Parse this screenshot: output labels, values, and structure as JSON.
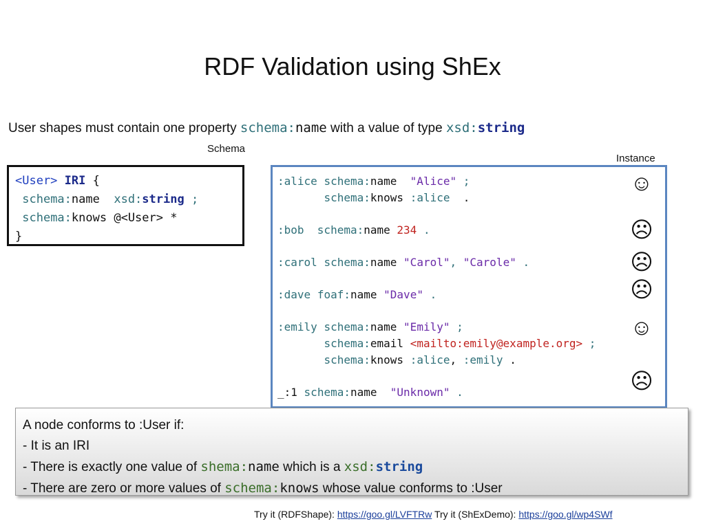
{
  "title": "RDF Validation using ShEx",
  "subtitle": {
    "prefix": "User shapes must contain one property ",
    "prop_prefix": "schema:",
    "prop_local": "name",
    "middle": " with a value of type ",
    "type_prefix": "xsd:",
    "type_local": "string"
  },
  "labels": {
    "schema": "Schema",
    "instance": "Instance"
  },
  "schema_code": {
    "l1_shape": "<User>",
    "l1_iri": "IRI",
    "l1_brace": " {",
    "l2_prefix": "schema:",
    "l2_prop": "name",
    "l2_type_prefix": "xsd:",
    "l2_type": "string",
    "l2_semi": " ;",
    "l3_prefix": "schema:",
    "l3_prop": "knows",
    "l3_ref": "@<User>",
    "l3_star": " *",
    "l4_close": "}"
  },
  "instance": {
    "alice": {
      "subj": ":alice",
      "p1_prefix": "schema:",
      "p1": "name",
      "v1": "\"Alice\"",
      "s1": " ;",
      "p2_prefix": "schema:",
      "p2": "knows",
      "v2": ":alice",
      "s2": "  ."
    },
    "bob": {
      "subj": ":bob",
      "p_prefix": "schema:",
      "p": "name",
      "v": "234",
      "s": " ."
    },
    "carol": {
      "subj": ":carol",
      "p_prefix": "schema:",
      "p": "name",
      "v1": "\"Carol\"",
      "comma": ",",
      "v2": "\"Carole\"",
      "s": " ."
    },
    "dave": {
      "subj": ":dave",
      "p_prefix": "foaf:",
      "p": "name",
      "v": "\"Dave\"",
      "s": " ."
    },
    "emily": {
      "subj": ":emily",
      "p1_prefix": "schema:",
      "p1": "name",
      "v1": "\"Emily\"",
      "s1": " ;",
      "p2_prefix": "schema:",
      "p2": "email",
      "v2": "<mailto:emily@example.org>",
      "s2": " ;",
      "p3_prefix": "schema:",
      "p3": "knows",
      "v3a": ":alice",
      "v3comma": ",",
      "v3b": ":emily",
      "s3": " ."
    },
    "blank": {
      "subj": "_:1",
      "p_prefix": "schema:",
      "p": "name",
      "v": "\"Unknown\"",
      "s": " ."
    }
  },
  "faces": {
    "happy": "☺",
    "sad": "☹"
  },
  "note": {
    "line1": "A node conforms to :User if:",
    "line2": "- It is an IRI",
    "line3_pre": "- There is exactly one value of ",
    "line3_prop_prefix": "shema:",
    "line3_prop": "name",
    "line3_mid": " which is a ",
    "line3_type_prefix": "xsd:",
    "line3_type": "string",
    "line4_pre": "- There are zero or more values of ",
    "line4_prop_prefix": "schema:",
    "line4_prop": "knows",
    "line4_post": "  whose value conforms to :User"
  },
  "footer": {
    "t1": "Try it (RDFShape): ",
    "link1": "https://goo.gl/LVFTRw",
    "t2": " Try it (ShExDemo): ",
    "link2": "https://goo.gl/wp4SWf"
  }
}
